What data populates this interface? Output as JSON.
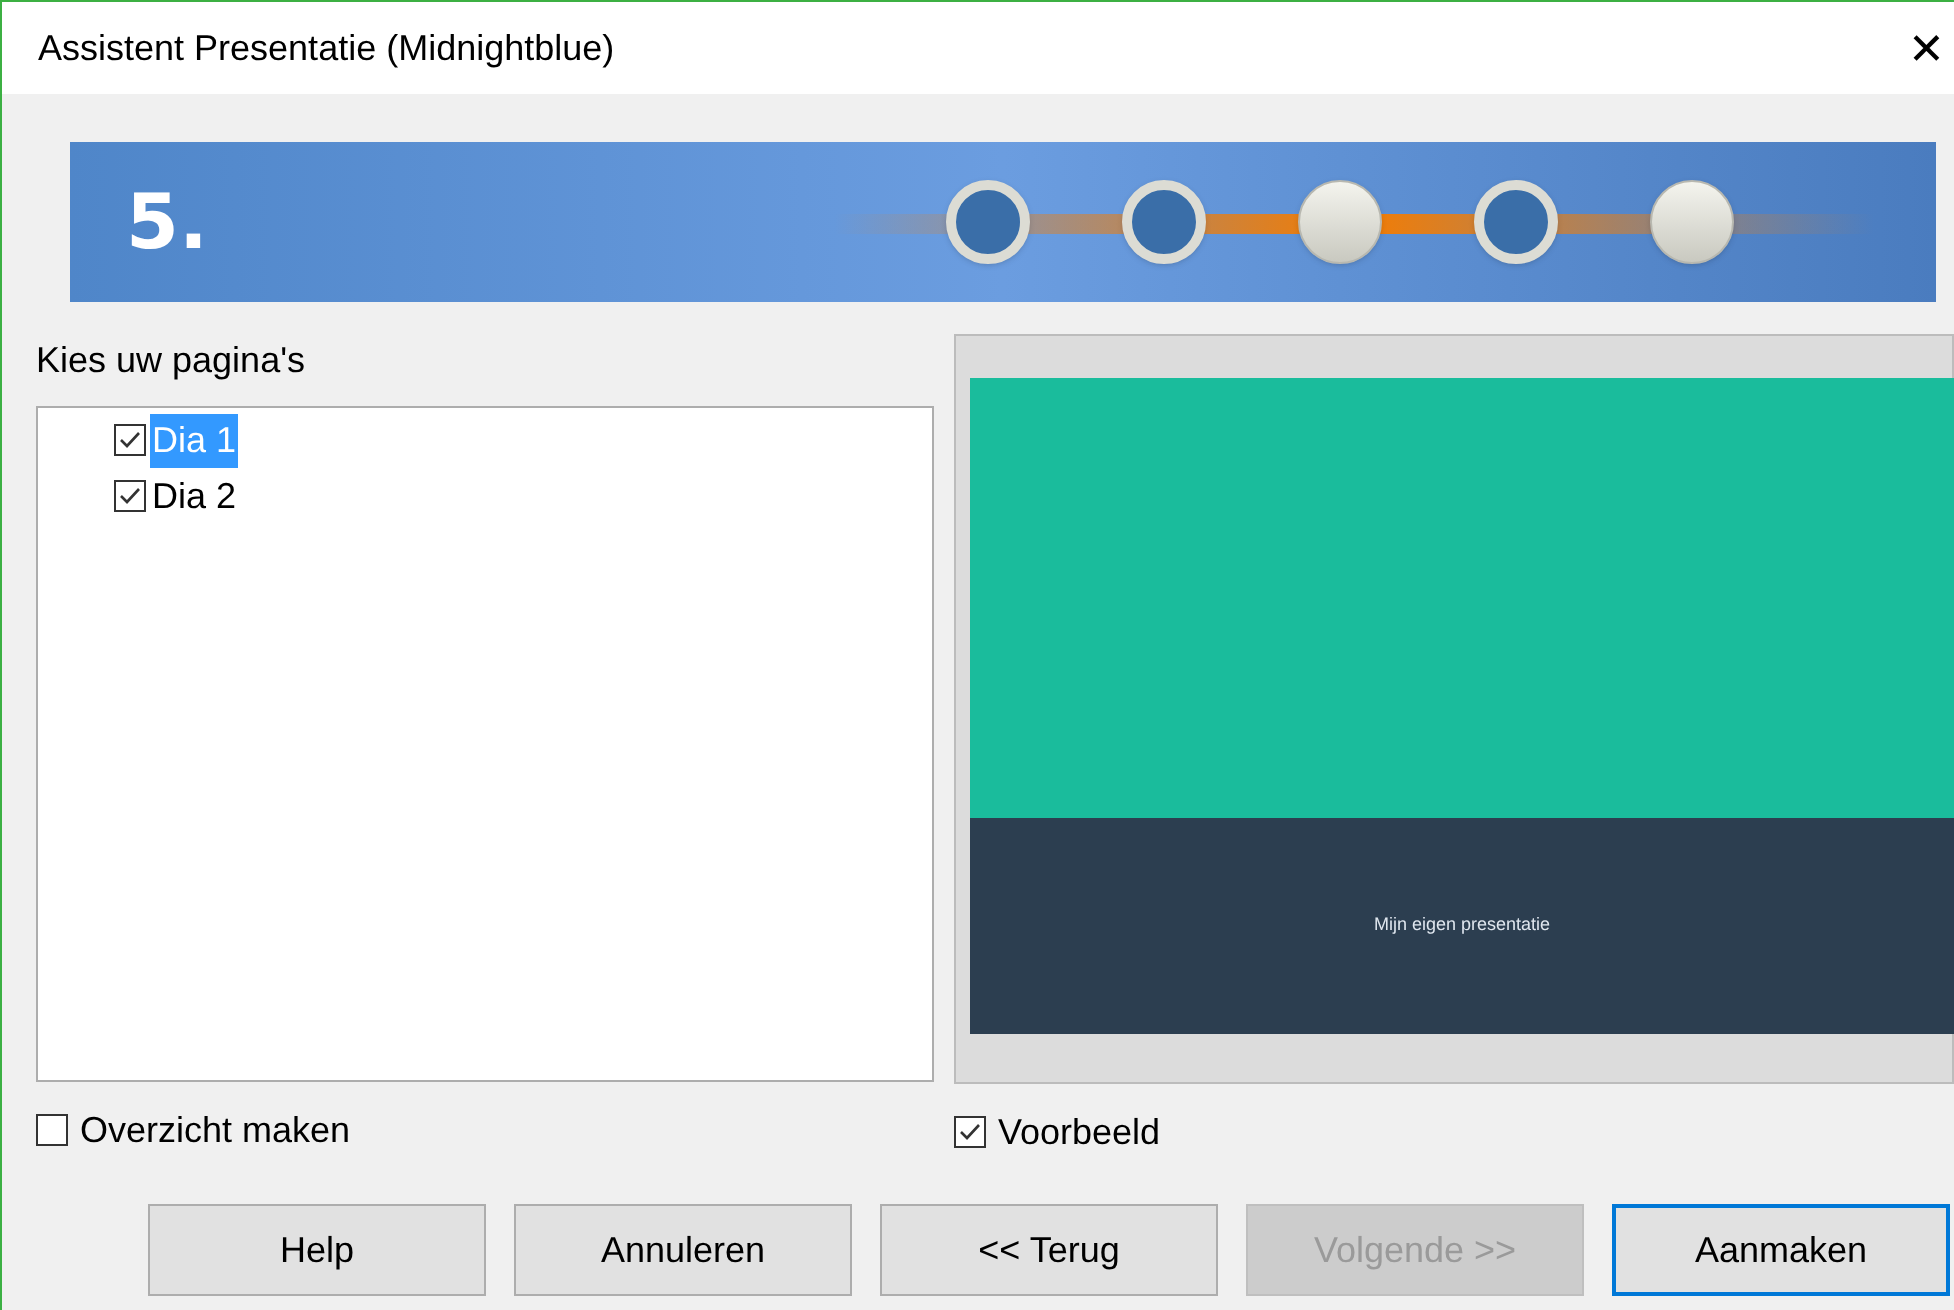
{
  "window": {
    "title": "Assistent Presentatie (Midnightblue)",
    "close": "✕"
  },
  "banner": {
    "step": "5.",
    "steps": [
      {
        "done": true
      },
      {
        "done": true
      },
      {
        "done": false
      },
      {
        "done": true
      },
      {
        "done": false
      }
    ]
  },
  "pages": {
    "label": "Kies uw pagina's",
    "items": [
      {
        "label": "Dia 1",
        "checked": true,
        "selected": true
      },
      {
        "label": "Dia 2",
        "checked": true,
        "selected": false
      }
    ]
  },
  "preview": {
    "slide_title": "Mijn eigen presentatie"
  },
  "options": [
    {
      "label": "Overzicht maken",
      "checked": false
    },
    {
      "label": "Voorbeeld",
      "checked": true
    }
  ],
  "buttons": [
    {
      "label": "Help",
      "disabled": false,
      "default": false
    },
    {
      "label": "Annuleren",
      "disabled": false,
      "default": false
    },
    {
      "label": "<< Terug",
      "disabled": false,
      "default": false
    },
    {
      "label": "Volgende >>",
      "disabled": true,
      "default": false
    },
    {
      "label": "Aanmaken",
      "disabled": false,
      "default": true
    }
  ]
}
